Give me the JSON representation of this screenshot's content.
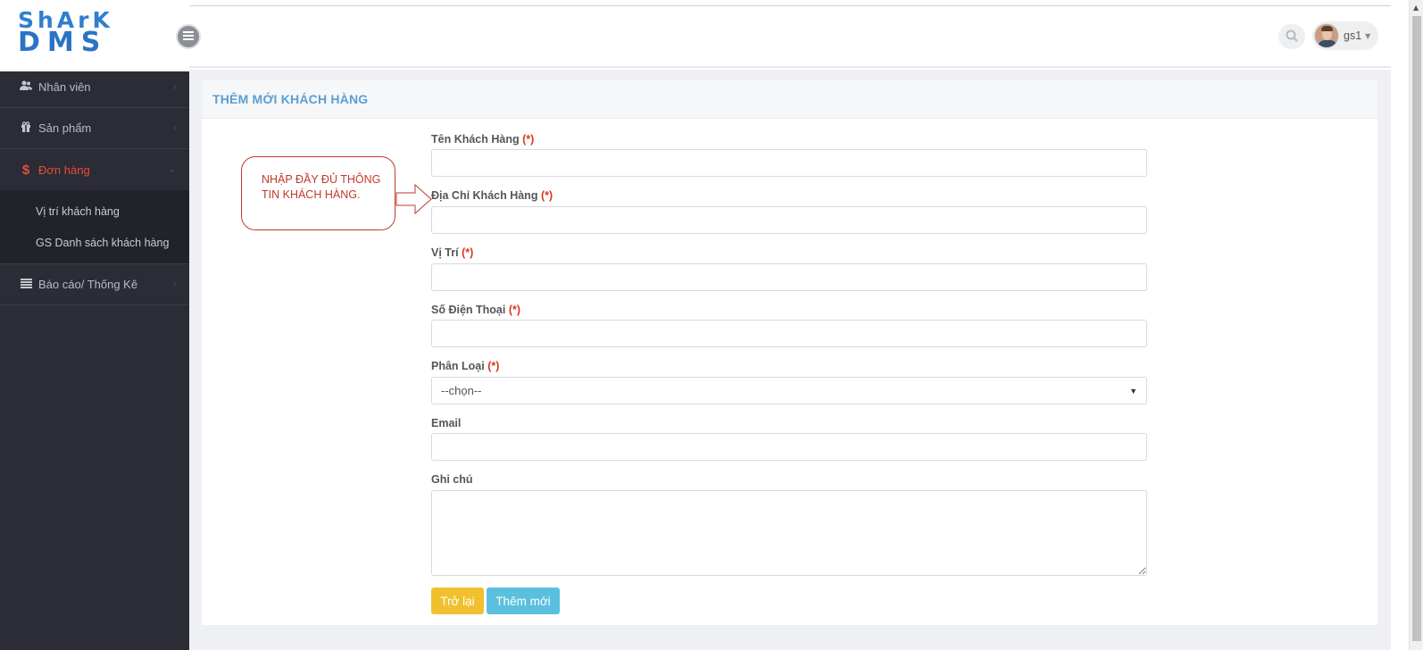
{
  "brand": {
    "logo_top": "ShArK",
    "logo_bottom": "DMS"
  },
  "sidebar": {
    "items": [
      {
        "label": "Nhân viên",
        "icon": "users-icon"
      },
      {
        "label": "Sản phẩm",
        "icon": "gift-icon"
      },
      {
        "label": "Đơn hàng",
        "icon": "dollar-icon",
        "active": true,
        "children": [
          {
            "label": "Vị trí khách hàng"
          },
          {
            "label": "GS Danh sách khách hàng"
          }
        ]
      },
      {
        "label": "Báo cáo/ Thống Kê",
        "icon": "list-icon"
      }
    ]
  },
  "header": {
    "username": "gs1"
  },
  "page": {
    "title": "THÊM MỚI KHÁCH HÀNG",
    "required_mark": "(*)",
    "fields": {
      "name": {
        "label": "Tên Khách Hàng",
        "value": ""
      },
      "address": {
        "label": "Địa Chỉ Khách Hàng",
        "value": ""
      },
      "location": {
        "label": "Vị Trí",
        "value": ""
      },
      "phone": {
        "label": "Số Điện Thoại",
        "value": ""
      },
      "category": {
        "label": "Phân Loại",
        "selected": "--chọn--"
      },
      "email": {
        "label": "Email",
        "value": ""
      },
      "note": {
        "label": "Ghi chú",
        "value": ""
      }
    },
    "buttons": {
      "back": "Trở lại",
      "add": "Thêm mới"
    }
  },
  "annotation": {
    "text_line1": "NHẬP ĐẦY ĐỦ THÔNG",
    "text_line2": "TIN KHÁCH HÀNG."
  },
  "colors": {
    "sidebar_bg": "#2b2c35",
    "active": "#e74c3c",
    "title": "#5a9fd4",
    "required": "#d9361e",
    "btn_back": "#f0c02f",
    "btn_add": "#5bc0de",
    "annotation": "#c0392b"
  }
}
